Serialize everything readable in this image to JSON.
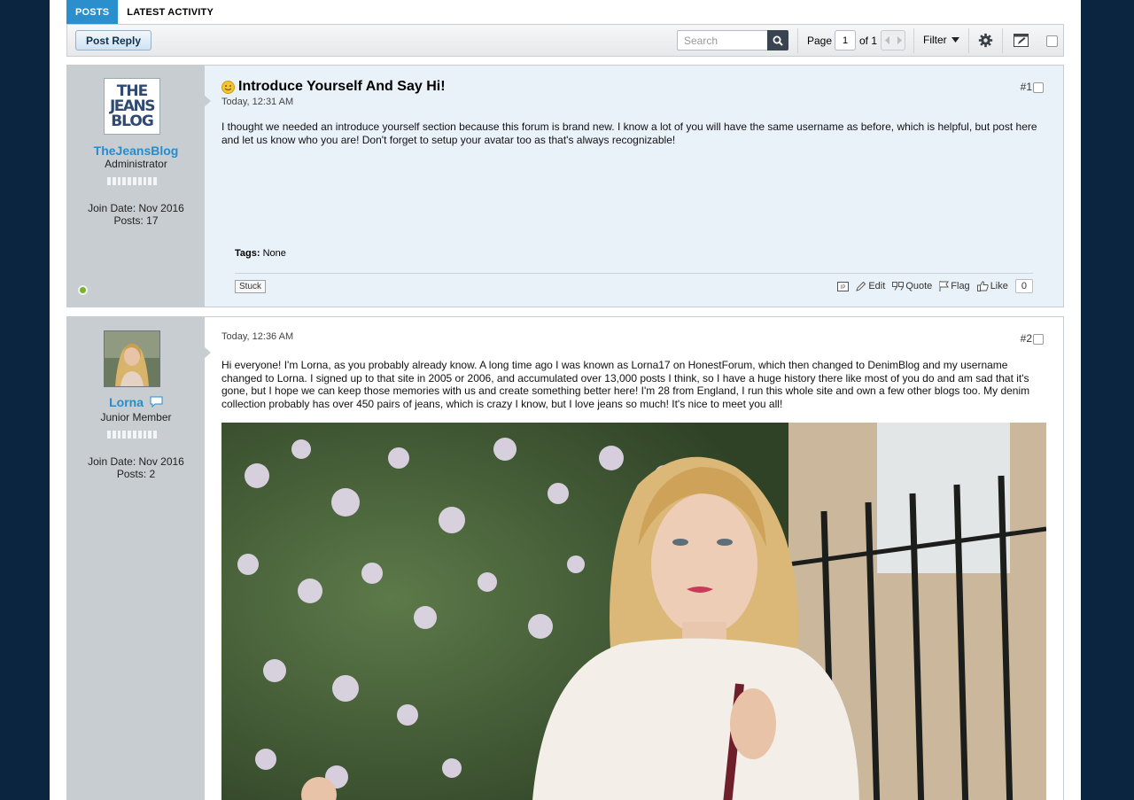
{
  "tabs": [
    {
      "label": "POSTS",
      "active": true
    },
    {
      "label": "LATEST ACTIVITY",
      "active": false
    }
  ],
  "toolbar": {
    "reply_label": "Post Reply",
    "search_placeholder": "Search",
    "page_label": "Page",
    "current_page": "1",
    "of_label": "of 1",
    "filter_label": "Filter"
  },
  "colors": {
    "accent": "#2b8fcd",
    "username": "#2a8bc9",
    "online": "#7ab32a"
  },
  "posts": [
    {
      "author": "TheJeansBlog",
      "avatar_text": [
        "THE",
        "JEANS",
        "BLOG"
      ],
      "user_title": "Administrator",
      "join_date": "Join Date: Nov 2016",
      "posts_count": "Posts: 17",
      "title": "Introduce Yourself And Say Hi!",
      "date": "Today, 12:31 AM",
      "number": "#1",
      "body": "I thought we needed an introduce yourself section because this forum is brand new. I know a lot of you will have the same username as before, which is helpful, but post here and let us know who you are! Don't forget to setup your avatar too as that's always recognizable!",
      "tags_label": "Tags:",
      "tags_value": "None",
      "stuck_label": "Stuck",
      "actions": {
        "edit": "Edit",
        "quote": "Quote",
        "flag": "Flag",
        "like": "Like",
        "like_count": "0"
      },
      "online": true
    },
    {
      "author": "Lorna",
      "user_title": "Junior Member",
      "join_date": "Join Date: Nov 2016",
      "posts_count": "Posts: 2",
      "date": "Today, 12:36 AM",
      "number": "#2",
      "body": "Hi everyone! I'm Lorna, as you probably already know. A long time ago I was known as Lorna17 on HonestForum, which then changed to DenimBlog and my username changed to Lorna. I signed up to that site in 2005 or 2006, and accumulated over 13,000 posts I think, so I have a huge history there like most of you do and am sad that it's gone, but I hope we can keep those memories with us and create something better here! I'm 28 from England, I run this whole site and own a few other blogs too. My denim collection probably has over 450 pairs of jeans, which is crazy I know, but I love jeans so much! It's nice to meet you all!"
    }
  ]
}
